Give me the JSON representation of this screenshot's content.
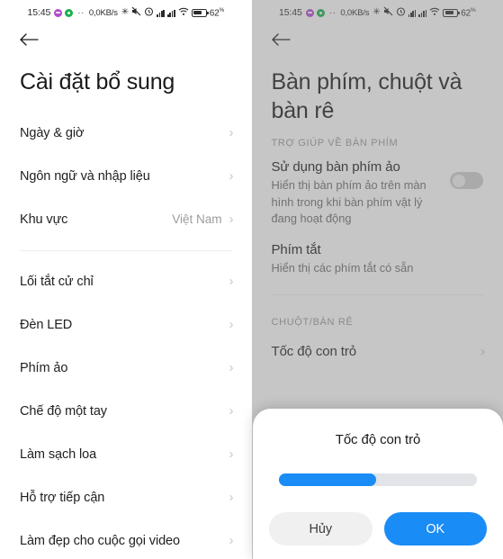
{
  "statusbar": {
    "time": "15:45",
    "icons": [
      "message-icon",
      "recorder-icon",
      "more-dots-icon"
    ],
    "dots": "··",
    "data_rate": "0,0KB/s",
    "bluetooth": "✳",
    "mute_vibrate": "🔇",
    "alarm": "⏰",
    "signal_1": "signal-bars-icon",
    "signal_2": "signal-bars-icon",
    "wifi": "wifi-icon",
    "battery_pct": "62",
    "battery_pct_suffix": "%"
  },
  "left_panel": {
    "back_icon": "back-arrow-icon",
    "title": "Cài đặt bổ sung",
    "group_1": [
      {
        "label": "Ngày & giờ",
        "value": "",
        "chevron": "›"
      },
      {
        "label": "Ngôn ngữ và nhập liệu",
        "value": "",
        "chevron": "›"
      },
      {
        "label": "Khu vực",
        "value": "Việt Nam",
        "chevron": "›"
      }
    ],
    "group_2": [
      {
        "label": "Lối tắt cử chỉ",
        "value": "",
        "chevron": "›"
      },
      {
        "label": "Đèn LED",
        "value": "",
        "chevron": "›"
      },
      {
        "label": "Phím ảo",
        "value": "",
        "chevron": "›"
      },
      {
        "label": "Chế độ một tay",
        "value": "",
        "chevron": "›"
      },
      {
        "label": "Làm sạch loa",
        "value": "",
        "chevron": "›"
      },
      {
        "label": "Hỗ trợ tiếp cận",
        "value": "",
        "chevron": "›"
      },
      {
        "label": "Làm đẹp cho cuộc gọi video",
        "value": "",
        "chevron": "›"
      }
    ]
  },
  "right_panel": {
    "back_icon": "back-arrow-icon",
    "title": "Bàn phím, chuột và bàn rê",
    "section_keyboard": {
      "caption": "TRỢ GIÚP VỀ BÀN PHÍM",
      "items": [
        {
          "title": "Sử dụng bàn phím ảo",
          "subtitle": "Hiển thị bàn phím ảo trên màn hình trong khi bàn phím vật lý đang hoạt động",
          "toggle": "off"
        },
        {
          "title": "Phím tắt",
          "subtitle": "Hiển thị các phím tắt có sẵn",
          "toggle": ""
        }
      ]
    },
    "section_mouse": {
      "caption": "CHUỘT/BÀN RÊ",
      "items": [
        {
          "label": "Tốc độ con trỏ",
          "chevron": "›"
        }
      ]
    }
  },
  "dialog": {
    "title": "Tốc độ con trỏ",
    "slider": {
      "percent": 49,
      "fill_color": "#1a8cf5",
      "track_color": "#e2e4e8"
    },
    "cancel_label": "Hủy",
    "ok_label": "OK"
  },
  "colors": {
    "accent": "#1a8cf5",
    "dim_overlay": "#b5b5b5",
    "text_primary": "#1a1a1a",
    "text_secondary": "#6e6e6e",
    "caption": "#9a9a9a"
  }
}
